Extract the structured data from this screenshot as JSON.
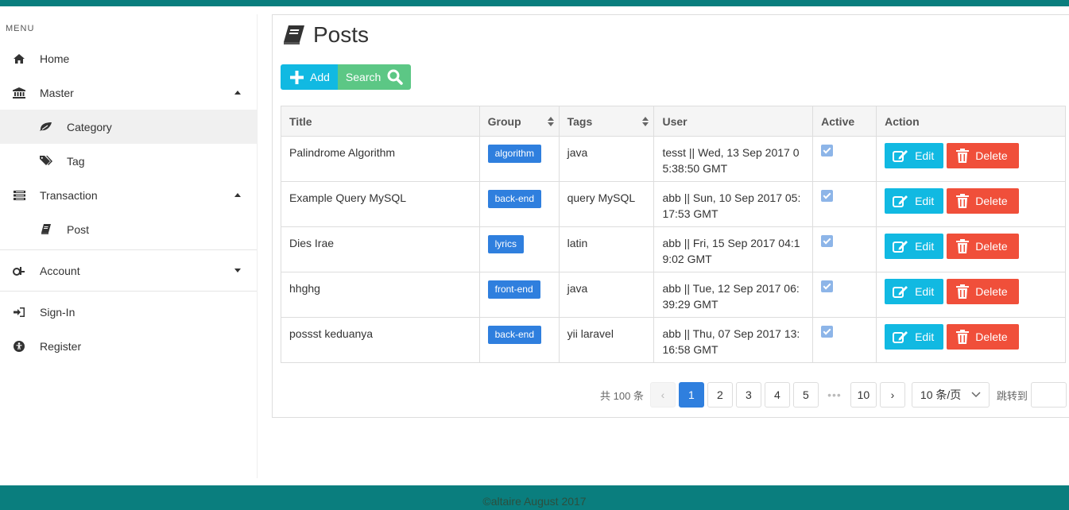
{
  "sidebar": {
    "menu_header": "MENU",
    "items": [
      {
        "label": "Home",
        "icon": "home-icon"
      },
      {
        "label": "Master",
        "icon": "bank-icon"
      },
      {
        "label": "Category",
        "icon": "leaf-icon"
      },
      {
        "label": "Tag",
        "icon": "tags-icon"
      },
      {
        "label": "Transaction",
        "icon": "list-icon"
      },
      {
        "label": "Post",
        "icon": "book-icon"
      },
      {
        "label": "Account",
        "icon": "account-icon"
      },
      {
        "label": "Sign-In",
        "icon": "sign-in-icon"
      },
      {
        "label": "Register",
        "icon": "universal-access-icon"
      }
    ]
  },
  "main": {
    "title": "Posts",
    "add_label": "Add",
    "search_label": "Search"
  },
  "table": {
    "headers": [
      "Title",
      "Group",
      "Tags",
      "User",
      "Active",
      "Action"
    ],
    "edit_label": "Edit",
    "delete_label": "Delete",
    "rows": [
      {
        "title": "Palindrome Algorithm",
        "group": "algorithm",
        "tags": "java",
        "user": "tesst || Wed, 13 Sep 2017 05:38:50 GMT",
        "active": true
      },
      {
        "title": "Example Query MySQL",
        "group": "back-end",
        "tags": "query MySQL",
        "user": "abb || Sun, 10 Sep 2017 05:17:53 GMT",
        "active": true
      },
      {
        "title": "Dies Irae",
        "group": "lyrics",
        "tags": "latin",
        "user": "abb || Fri, 15 Sep 2017 04:19:02 GMT",
        "active": true
      },
      {
        "title": "hhghg",
        "group": "front-end",
        "tags": "java",
        "user": "abb || Tue, 12 Sep 2017 06:39:29 GMT",
        "active": true
      },
      {
        "title": "possst keduanya",
        "group": "back-end",
        "tags": "yii laravel",
        "user": "abb || Thu, 07 Sep 2017 13:16:58 GMT",
        "active": true
      }
    ]
  },
  "pagination": {
    "total": "共 100 条",
    "prev": "‹",
    "pages": [
      "1",
      "2",
      "3",
      "4",
      "5"
    ],
    "ellipsis": "•••",
    "last": "10",
    "next": "›",
    "page_size": "10 条/页",
    "jump_label": "跳转到",
    "current_page": 1
  },
  "footer": {
    "text": "©altaire August 2017"
  },
  "colors": {
    "brand": "#0a7e7e",
    "primary": "#2f7fde",
    "info": "#11b9e2",
    "success": "#5cc785",
    "danger": "#f04f3a"
  }
}
